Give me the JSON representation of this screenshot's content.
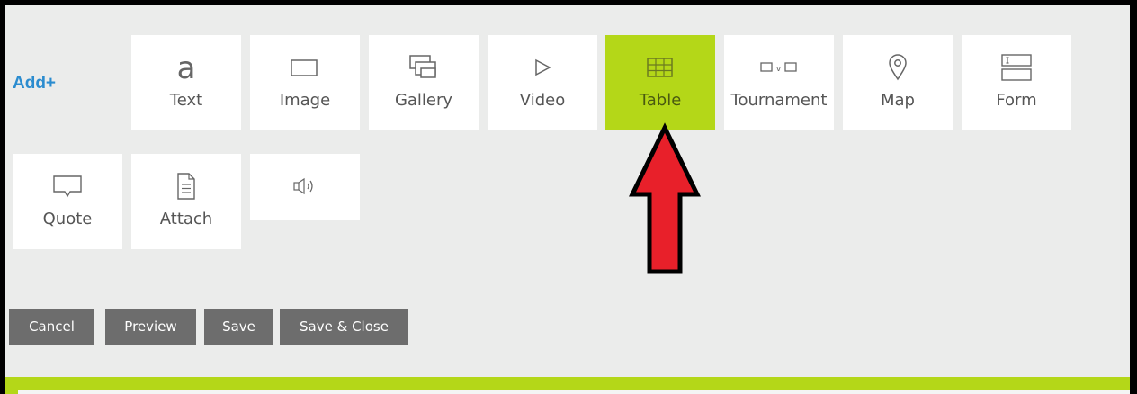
{
  "add_label": "Add+",
  "tiles": {
    "text": {
      "label": "Text",
      "icon": "text-a-icon"
    },
    "image": {
      "label": "Image",
      "icon": "image-icon"
    },
    "gallery": {
      "label": "Gallery",
      "icon": "gallery-icon"
    },
    "video": {
      "label": "Video",
      "icon": "play-icon"
    },
    "table": {
      "label": "Table",
      "icon": "table-icon",
      "active": true
    },
    "tournament": {
      "label": "Tournament",
      "icon": "tournament-icon"
    },
    "map": {
      "label": "Map",
      "icon": "map-pin-icon"
    },
    "form": {
      "label": "Form",
      "icon": "form-icon"
    },
    "quote": {
      "label": "Quote",
      "icon": "speech-bubble-icon"
    },
    "attach": {
      "label": "Attach",
      "icon": "document-icon"
    },
    "audio": {
      "label": "",
      "icon": "speaker-icon"
    }
  },
  "buttons": {
    "cancel": "Cancel",
    "preview": "Preview",
    "save": "Save",
    "save_close": "Save & Close"
  },
  "colors": {
    "accent_green": "#b4d718",
    "link_blue": "#2b8ccf",
    "button_gray": "#6d6d6d",
    "annotation_arrow": "#e8202a"
  }
}
